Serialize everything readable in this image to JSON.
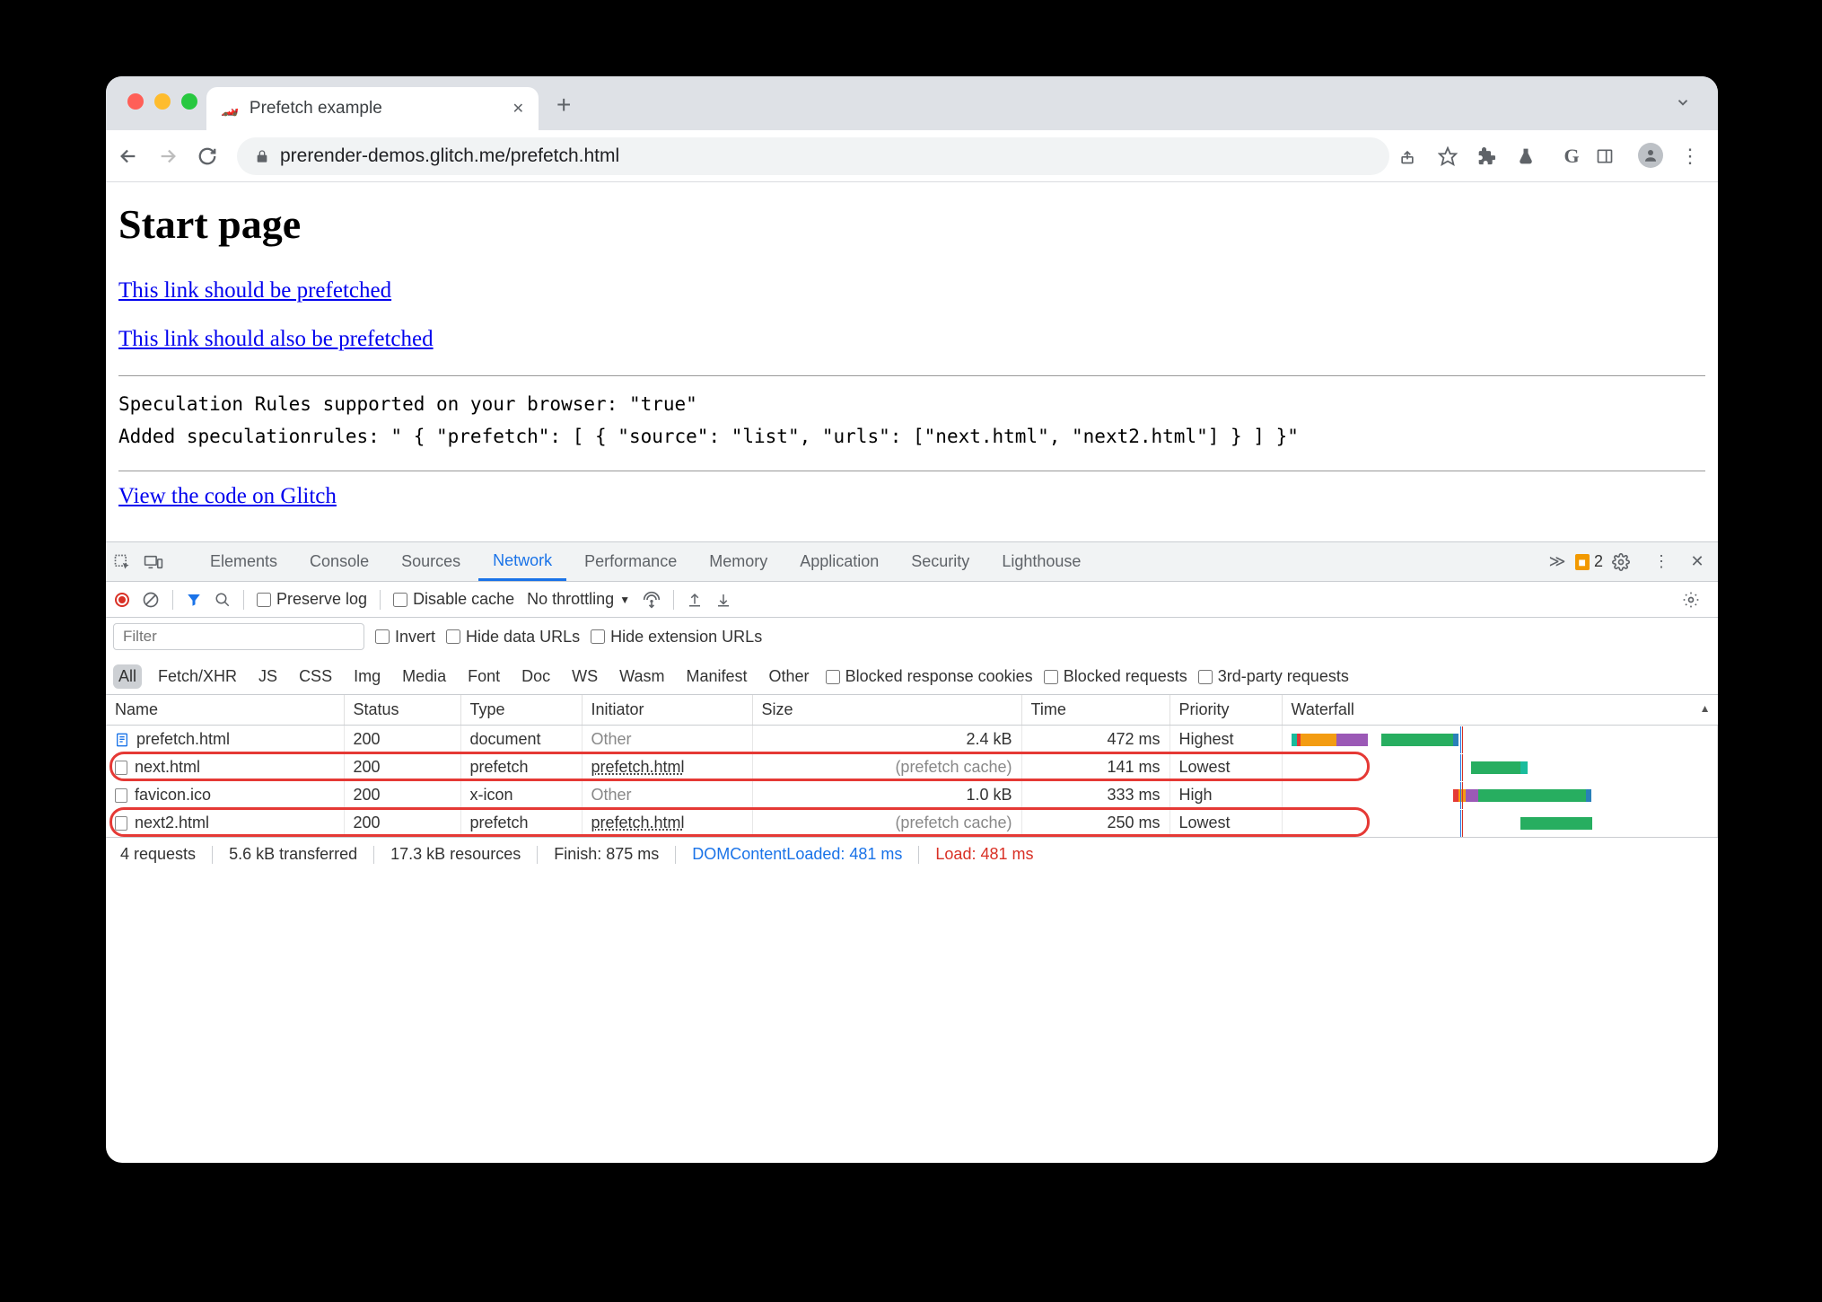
{
  "tab": {
    "title": "Prefetch example"
  },
  "url": "prerender-demos.glitch.me/prefetch.html",
  "page": {
    "heading": "Start page",
    "link1": "This link should be prefetched",
    "link2": "This link should also be prefetched",
    "code1": "Speculation Rules supported on your browser: \"true\"",
    "code2": "Added speculationrules: \" { \"prefetch\": [ { \"source\": \"list\", \"urls\": [\"next.html\", \"next2.html\"] } ] }\"",
    "link3": "View the code on Glitch"
  },
  "devtools": {
    "tabs": {
      "elements": "Elements",
      "console": "Console",
      "sources": "Sources",
      "network": "Network",
      "performance": "Performance",
      "memory": "Memory",
      "application": "Application",
      "security": "Security",
      "lighthouse": "Lighthouse"
    },
    "issues": "2",
    "toolbar": {
      "preserve_log": "Preserve log",
      "disable_cache": "Disable cache",
      "throttling": "No throttling"
    },
    "filterrow": {
      "placeholder": "Filter",
      "invert": "Invert",
      "hide_data": "Hide data URLs",
      "hide_ext": "Hide extension URLs",
      "blocked_cookies": "Blocked response cookies",
      "blocked_req": "Blocked requests",
      "third_party": "3rd-party requests",
      "types": {
        "all": "All",
        "fetchxhr": "Fetch/XHR",
        "js": "JS",
        "css": "CSS",
        "img": "Img",
        "media": "Media",
        "font": "Font",
        "doc": "Doc",
        "ws": "WS",
        "wasm": "Wasm",
        "manifest": "Manifest",
        "other": "Other"
      }
    },
    "columns": {
      "name": "Name",
      "status": "Status",
      "type": "Type",
      "initiator": "Initiator",
      "size": "Size",
      "time": "Time",
      "priority": "Priority",
      "waterfall": "Waterfall"
    },
    "rows": [
      {
        "name": "prefetch.html",
        "status": "200",
        "type": "document",
        "initiator": "Other",
        "initiator_grey": true,
        "size": "2.4 kB",
        "time": "472 ms",
        "priority": "Highest",
        "icon": "doc"
      },
      {
        "name": "next.html",
        "status": "200",
        "type": "prefetch",
        "initiator": "prefetch.html",
        "initiator_grey": false,
        "size": "(prefetch cache)",
        "size_grey": true,
        "time": "141 ms",
        "priority": "Lowest",
        "icon": "blank"
      },
      {
        "name": "favicon.ico",
        "status": "200",
        "type": "x-icon",
        "initiator": "Other",
        "initiator_grey": true,
        "size": "1.0 kB",
        "time": "333 ms",
        "priority": "High",
        "icon": "blank"
      },
      {
        "name": "next2.html",
        "status": "200",
        "type": "prefetch",
        "initiator": "prefetch.html",
        "initiator_grey": false,
        "size": "(prefetch cache)",
        "size_grey": true,
        "time": "250 ms",
        "priority": "Lowest",
        "icon": "blank"
      }
    ],
    "status": {
      "requests": "4 requests",
      "transferred": "5.6 kB transferred",
      "resources": "17.3 kB resources",
      "finish": "Finish: 875 ms",
      "dcl": "DOMContentLoaded: 481 ms",
      "load": "Load: 481 ms"
    }
  }
}
